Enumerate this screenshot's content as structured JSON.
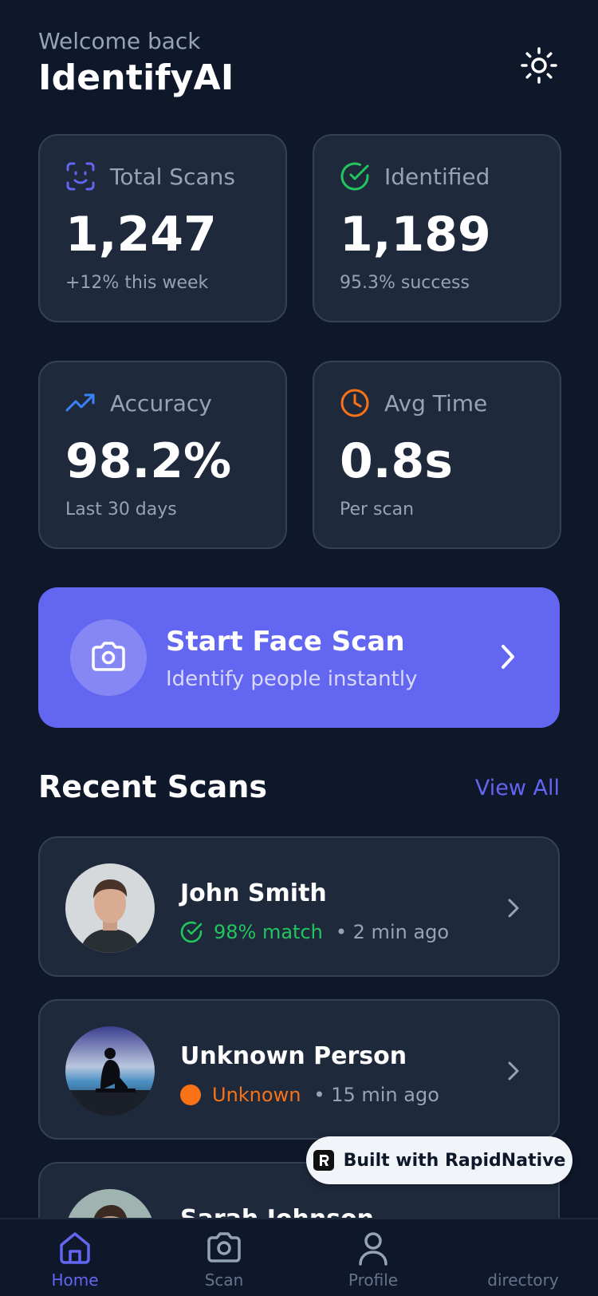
{
  "header": {
    "welcome": "Welcome back",
    "title": "IdentifyAI"
  },
  "stats": [
    {
      "icon": "face-scan-icon",
      "label": "Total Scans",
      "value": "1,247",
      "sub": "+12% this week",
      "color": "#6366f1"
    },
    {
      "icon": "check-circle-icon",
      "label": "Identified",
      "value": "1,189",
      "sub": "95.3% success",
      "color": "#22c55e"
    },
    {
      "icon": "trending-up-icon",
      "label": "Accuracy",
      "value": "98.2%",
      "sub": "Last 30 days",
      "color": "#3b82f6"
    },
    {
      "icon": "clock-icon",
      "label": "Avg Time",
      "value": "0.8s",
      "sub": "Per scan",
      "color": "#f97316"
    }
  ],
  "cta": {
    "title": "Start Face Scan",
    "subtitle": "Identify people instantly"
  },
  "recent": {
    "title": "Recent Scans",
    "view_all": "View All",
    "items": [
      {
        "name": "John Smith",
        "status": "98% match",
        "time": "• 2 min ago",
        "status_color": "#22c55e"
      },
      {
        "name": "Unknown Person",
        "status": "Unknown",
        "time": "• 15 min ago",
        "status_color": "#f97316"
      },
      {
        "name": "Sarah Johnson",
        "status": "",
        "time": ""
      }
    ]
  },
  "badge": {
    "text": "Built with RapidNative"
  },
  "tabs": [
    {
      "label": "Home",
      "icon": "home-icon",
      "active": true
    },
    {
      "label": "Scan",
      "icon": "camera-icon",
      "active": false
    },
    {
      "label": "Profile",
      "icon": "user-icon",
      "active": false
    },
    {
      "label": "directory",
      "icon": "directory-icon",
      "active": false
    }
  ],
  "colors": {
    "background": "#0f172a",
    "card": "#1e293b",
    "accent": "#6366f1",
    "success": "#22c55e",
    "warning": "#f97316"
  }
}
